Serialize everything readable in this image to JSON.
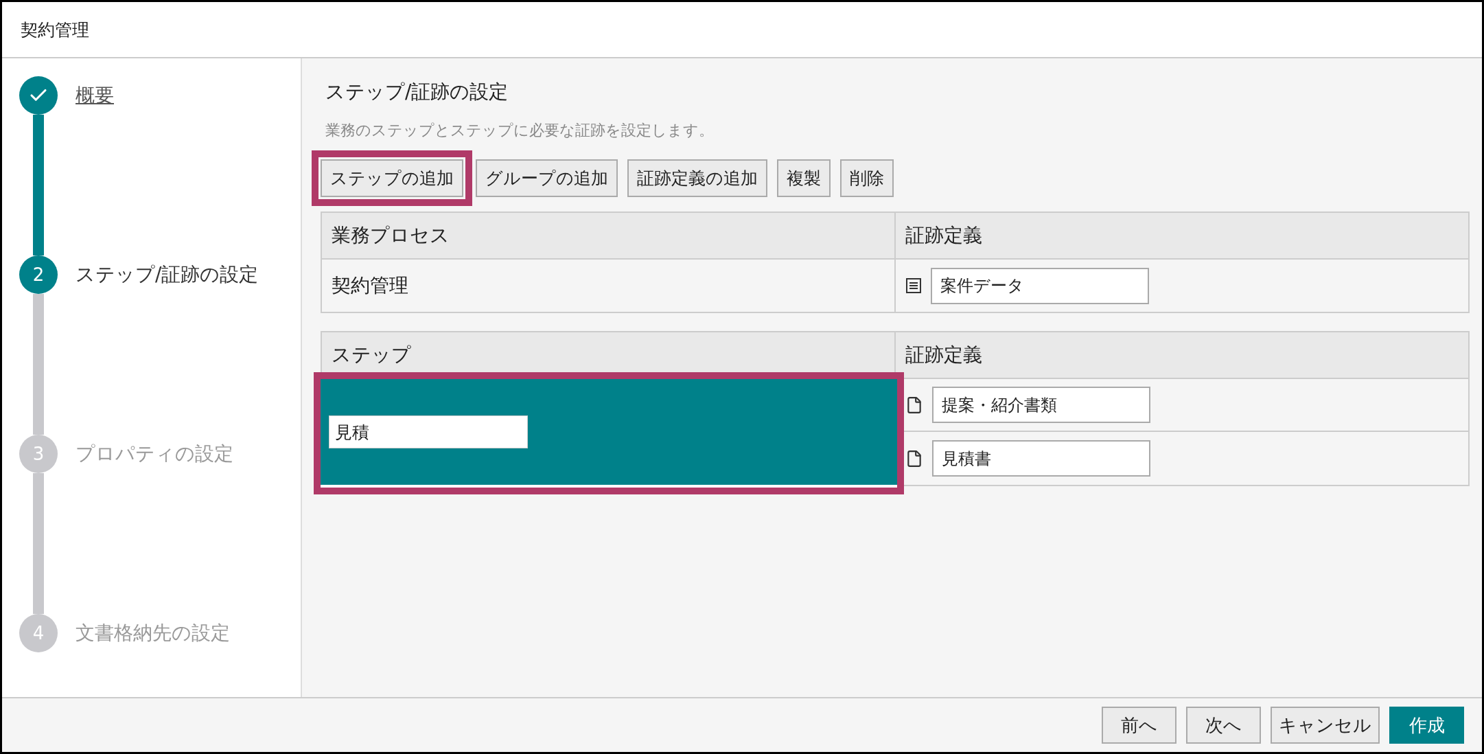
{
  "window": {
    "title": "契約管理"
  },
  "wizard_steps": [
    {
      "label": "概要",
      "kind": "done"
    },
    {
      "number": "2",
      "label": "ステップ/証跡の設定",
      "kind": "current"
    },
    {
      "number": "3",
      "label": "プロパティの設定",
      "kind": "pending"
    },
    {
      "number": "4",
      "label": "文書格納先の設定",
      "kind": "pending"
    }
  ],
  "page": {
    "heading": "ステップ/証跡の設定",
    "description": "業務のステップとステップに必要な証跡を設定します。"
  },
  "toolbar": [
    {
      "label": "ステップの追加",
      "highlighted": true
    },
    {
      "label": "グループの追加",
      "highlighted": false
    },
    {
      "label": "証跡定義の追加",
      "highlighted": false
    },
    {
      "label": "複製",
      "highlighted": false
    },
    {
      "label": "削除",
      "highlighted": false
    }
  ],
  "process_table": {
    "columns": [
      "業務プロセス",
      "証跡定義"
    ],
    "rows": [
      {
        "name": "契約管理",
        "evidence": [
          {
            "kind": "data",
            "value": "案件データ"
          }
        ]
      }
    ]
  },
  "step_table": {
    "columns": [
      "ステップ",
      "証跡定義"
    ],
    "rows": [
      {
        "name": "見積",
        "selected": true,
        "highlighted": true,
        "evidence": [
          {
            "kind": "document",
            "value": "提案・紹介書類"
          },
          {
            "kind": "document",
            "value": "見積書"
          }
        ]
      }
    ]
  },
  "footer_buttons": [
    {
      "label": "前へ",
      "primary": false
    },
    {
      "label": "次へ",
      "primary": false
    },
    {
      "label": "キャンセル",
      "primary": false
    },
    {
      "label": "作成",
      "primary": true
    }
  ]
}
